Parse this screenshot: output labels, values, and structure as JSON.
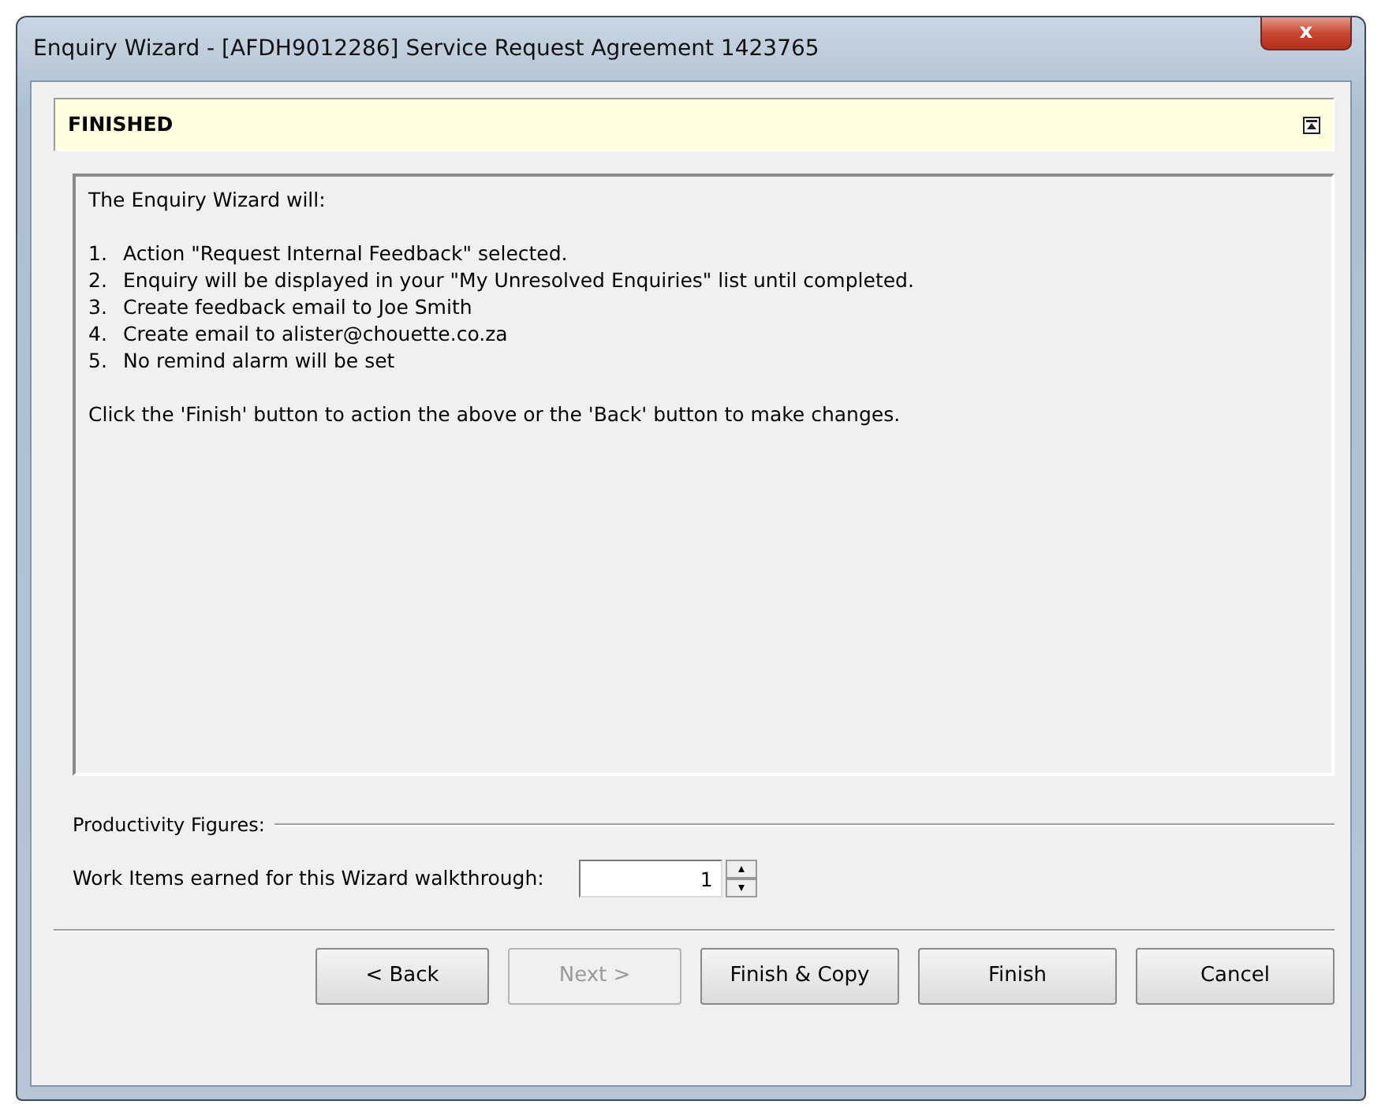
{
  "window": {
    "title": "Enquiry Wizard - [AFDH9012286] Service Request Agreement 1423765",
    "close": "x"
  },
  "header": {
    "title": "FINISHED"
  },
  "summary": {
    "intro": "The Enquiry Wizard will:",
    "steps": [
      {
        "number": "1.",
        "text": "Action \"Request Internal Feedback\" selected."
      },
      {
        "number": "2.",
        "text": "Enquiry will be displayed in your \"My Unresolved Enquiries\" list until completed."
      },
      {
        "number": "3.",
        "text": "Create feedback email to Joe Smith"
      },
      {
        "number": "4.",
        "text": "Create email to alister@chouette.co.za"
      },
      {
        "number": "5.",
        "text": "No remind alarm will be set"
      }
    ],
    "outro": "Click the 'Finish' button to action the above or the 'Back' button to make changes."
  },
  "productivity": {
    "group_label": "Productivity Figures:",
    "field_label": "Work Items earned for this Wizard walkthrough:",
    "value": "1"
  },
  "buttons": [
    {
      "label": "< Back",
      "disabled": false
    },
    {
      "label": "Next >",
      "disabled": true
    },
    {
      "label": "Finish & Copy",
      "disabled": false
    },
    {
      "label": "Finish",
      "disabled": false
    },
    {
      "label": "Cancel",
      "disabled": false
    }
  ]
}
